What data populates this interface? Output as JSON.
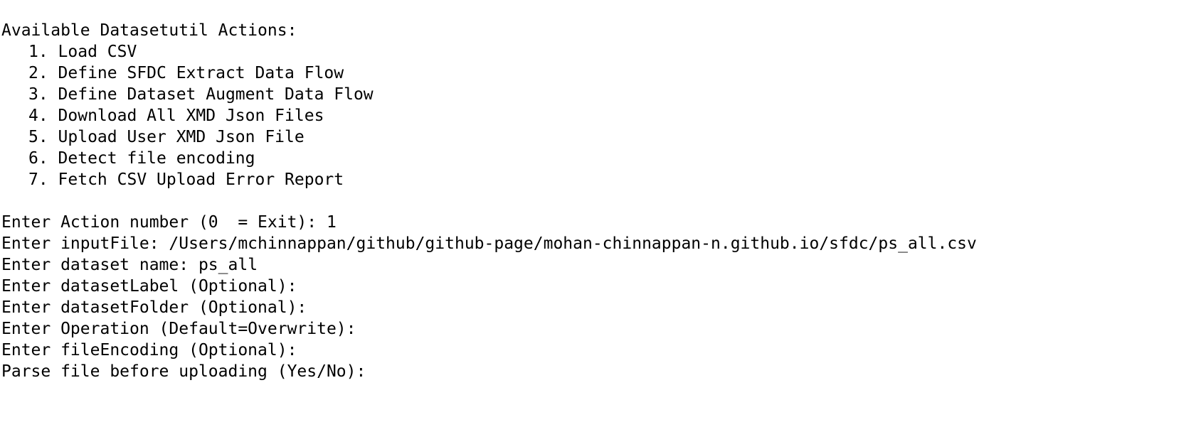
{
  "menu": {
    "title": "Available Datasetutil Actions:",
    "items": [
      {
        "label": "1. Load CSV"
      },
      {
        "label": "2. Define SFDC Extract Data Flow"
      },
      {
        "label": "3. Define Dataset Augment Data Flow"
      },
      {
        "label": "4. Download All XMD Json Files"
      },
      {
        "label": "5. Upload User XMD Json File"
      },
      {
        "label": "6. Detect file encoding"
      },
      {
        "label": "7. Fetch CSV Upload Error Report"
      }
    ]
  },
  "session": {
    "prompts": [
      {
        "label": "Enter Action number (0  = Exit): ",
        "value": "1"
      },
      {
        "label": "Enter inputFile: ",
        "value": "/Users/mchinnappan/github/github-page/mohan-chinnappan-n.github.io/sfdc/ps_all.csv"
      },
      {
        "label": "Enter dataset name: ",
        "value": "ps_all"
      },
      {
        "label": "Enter datasetLabel (Optional):",
        "value": ""
      },
      {
        "label": "Enter datasetFolder (Optional):",
        "value": ""
      },
      {
        "label": "Enter Operation (Default=Overwrite):",
        "value": ""
      },
      {
        "label": "Enter fileEncoding (Optional):",
        "value": ""
      },
      {
        "label": "Parse file before uploading (Yes/No):",
        "value": ""
      }
    ]
  }
}
